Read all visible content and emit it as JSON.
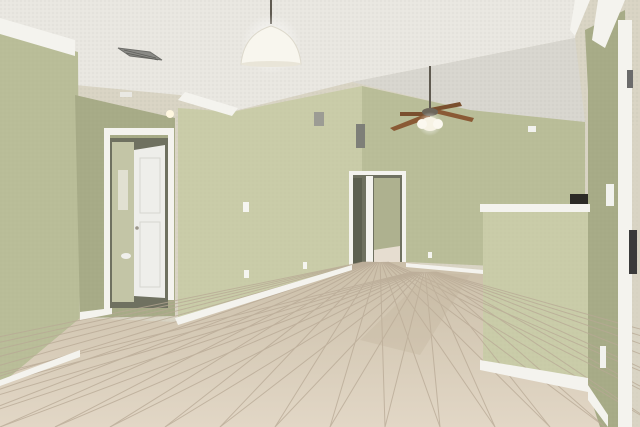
{
  "scene": {
    "subject": "empty-room-interior",
    "colors": {
      "wall": "#b9bd98",
      "wall_light": "#c9cca8",
      "wall_shadow": "#a7ab87",
      "ceiling": "#e9e7e1",
      "ceiling_shadow": "#d8d6cf",
      "floor_tile": "#d8cbb8",
      "floor_grout": "#b8a995",
      "trim": "#f4f3ee",
      "door": "#eeeeea",
      "doorway_dark": "#6f7160",
      "fan_wood": "#8a5a35",
      "fixture_glass": "#f8f6ee",
      "metal": "#5f5a50"
    }
  }
}
